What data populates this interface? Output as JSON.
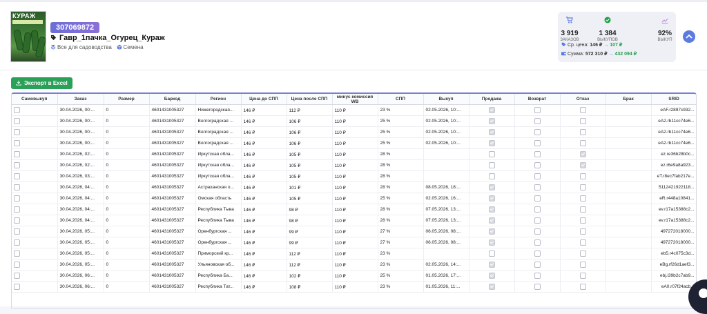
{
  "product": {
    "brand_logo": "КУРАЖ",
    "sku": "307069872",
    "name": "Гавр_1пачка_Огурец_Кураж",
    "category": "Все для садоводства",
    "subcategory": "Семена"
  },
  "stats": {
    "orders_value": "3 919",
    "orders_label": "ЗАКАЗОВ",
    "buyouts_value": "1 384",
    "buyouts_label": "ВЫКУПОВ",
    "buyout_pct_value": "92%",
    "buyout_pct_label": "ВЫКУП",
    "avg_price_label": "Ср. цена:",
    "avg_price_from": "146 ₽",
    "avg_price_to": "107 ₽",
    "sum_label": "Сумма:",
    "sum_from": "572 310 ₽",
    "sum_to": "432 094 ₽",
    "arrow": "→",
    "colors": {
      "orders": "#5b7be0",
      "buyouts": "#23a04a",
      "pct": "#b97de0"
    }
  },
  "toolbar": {
    "export_label": "Экспорт в Excel"
  },
  "table": {
    "columns": [
      "Самовыкуп",
      "Заказ",
      "Размер",
      "Баркод",
      "Регион",
      "Цена до СПП",
      "Цена после СПП",
      "минус комиссия WB",
      "СПП",
      "Выкуп",
      "Продажа",
      "Возврат",
      "Отказ",
      "Брак",
      "SRID"
    ],
    "rows": [
      {
        "order": "30.04.2026, 00:...",
        "size": "0",
        "barcode": "4601431005327",
        "region": "Нижегородская...",
        "p1": "146 ₽",
        "p2": "112 ₽",
        "p3": "110 ₽",
        "spp": "23 %",
        "buyout": "02.05.2026, 10:...",
        "sale": true,
        "refusal": false,
        "srid": "eAF.r2897c932..."
      },
      {
        "order": "30.04.2026, 00:...",
        "size": "0",
        "barcode": "4601431005327",
        "region": "Волгоградская ...",
        "p1": "146 ₽",
        "p2": "106 ₽",
        "p3": "110 ₽",
        "spp": "25 %",
        "buyout": "02.05.2026, 10:...",
        "sale": true,
        "refusal": false,
        "srid": "eA2.rb11cc74e6..."
      },
      {
        "order": "30.04.2026, 00:...",
        "size": "0",
        "barcode": "4601431005327",
        "region": "Волгоградская ...",
        "p1": "146 ₽",
        "p2": "106 ₽",
        "p3": "110 ₽",
        "spp": "25 %",
        "buyout": "02.05.2026, 10:...",
        "sale": true,
        "refusal": false,
        "srid": "eA2.rb11cc74e6..."
      },
      {
        "order": "30.04.2026, 00:...",
        "size": "0",
        "barcode": "4601431005327",
        "region": "Волгоградская ...",
        "p1": "146 ₽",
        "p2": "106 ₽",
        "p3": "110 ₽",
        "spp": "25 %",
        "buyout": "02.05.2026, 10:...",
        "sale": true,
        "refusal": false,
        "srid": "eA2.rb11cc74e6..."
      },
      {
        "order": "30.04.2026, 02:...",
        "size": "0",
        "barcode": "4601431005327",
        "region": "Иркутская обла...",
        "p1": "146 ₽",
        "p2": "105 ₽",
        "p3": "110 ₽",
        "spp": "28 %",
        "buyout": "",
        "sale": false,
        "refusal": true,
        "srid": "ez.re36b28b0c..."
      },
      {
        "order": "30.04.2026, 02:...",
        "size": "0",
        "barcode": "4601431005327",
        "region": "Иркутская обла...",
        "p1": "146 ₽",
        "p2": "105 ₽",
        "p3": "110 ₽",
        "spp": "28 %",
        "buyout": "",
        "sale": false,
        "refusal": true,
        "srid": "ez.r6e9a8a923..."
      },
      {
        "order": "30.04.2026, 03:...",
        "size": "0",
        "barcode": "4601431005327",
        "region": "Иркутская обла...",
        "p1": "146 ₽",
        "p2": "105 ₽",
        "p3": "110 ₽",
        "spp": "28 %",
        "buyout": "",
        "sale": false,
        "refusal": false,
        "srid": "eT.r8ec7fab217e..."
      },
      {
        "order": "30.04.2026, 04:...",
        "size": "0",
        "barcode": "4601431005327",
        "region": "Астраханская о...",
        "p1": "146 ₽",
        "p2": "101 ₽",
        "p3": "110 ₽",
        "spp": "28 %",
        "buyout": "08.05.2026, 18:...",
        "sale": true,
        "refusal": false,
        "srid": "5112421922118..."
      },
      {
        "order": "30.04.2026, 04:...",
        "size": "0",
        "barcode": "4601431005327",
        "region": "Омская область",
        "p1": "146 ₽",
        "p2": "105 ₽",
        "p3": "110 ₽",
        "spp": "25 %",
        "buyout": "02.05.2026, 16:...",
        "sale": true,
        "refusal": false,
        "srid": "eR.r448a10841..."
      },
      {
        "order": "30.04.2026, 04:...",
        "size": "0",
        "barcode": "4601431005327",
        "region": "Республика Тыва",
        "p1": "146 ₽",
        "p2": "98 ₽",
        "p3": "110 ₽",
        "spp": "28 %",
        "buyout": "07.05.2026, 13:...",
        "sale": true,
        "refusal": false,
        "srid": "ev.r17a15388c2..."
      },
      {
        "order": "30.04.2026, 04:...",
        "size": "0",
        "barcode": "4601431005327",
        "region": "Республика Тыва",
        "p1": "146 ₽",
        "p2": "98 ₽",
        "p3": "110 ₽",
        "spp": "28 %",
        "buyout": "07.05.2026, 13:...",
        "sale": true,
        "refusal": false,
        "srid": "ev.r17a15388c2..."
      },
      {
        "order": "30.04.2026, 05:...",
        "size": "0",
        "barcode": "4601431005327",
        "region": "Оренбургская ...",
        "p1": "146 ₽",
        "p2": "99 ₽",
        "p3": "110 ₽",
        "spp": "27 %",
        "buyout": "06.05.2026, 08:...",
        "sale": true,
        "refusal": false,
        "srid": "497272018000..."
      },
      {
        "order": "30.04.2026, 05:...",
        "size": "0",
        "barcode": "4601431005327",
        "region": "Оренбургская ...",
        "p1": "146 ₽",
        "p2": "99 ₽",
        "p3": "110 ₽",
        "spp": "27 %",
        "buyout": "06.05.2026, 08:...",
        "sale": true,
        "refusal": false,
        "srid": "497272018000..."
      },
      {
        "order": "30.04.2026, 05:...",
        "size": "0",
        "barcode": "4601431005327",
        "region": "Приморский кр...",
        "p1": "146 ₽",
        "p2": "112 ₽",
        "p3": "110 ₽",
        "spp": "23 %",
        "buyout": "",
        "sale": false,
        "refusal": false,
        "srid": "eb5.r4c075c3d..."
      },
      {
        "order": "30.04.2026, 05:...",
        "size": "0",
        "barcode": "4601431005327",
        "region": "Ульяновская об...",
        "p1": "146 ₽",
        "p2": "112 ₽",
        "p3": "110 ₽",
        "spp": "23 %",
        "buyout": "02.05.2026, 14:...",
        "sale": true,
        "refusal": false,
        "srid": "eBg.rf26d1aef3..."
      },
      {
        "order": "30.04.2026, 06:...",
        "size": "0",
        "barcode": "4601431005327",
        "region": "Республика Ба...",
        "p1": "146 ₽",
        "p2": "102 ₽",
        "p3": "110 ₽",
        "spp": "25 %",
        "buyout": "01.05.2026, 17:...",
        "sale": true,
        "refusal": false,
        "srid": "ebj.i39b2c7ab9..."
      },
      {
        "order": "30.04.2026, 06:...",
        "size": "0",
        "barcode": "4601431005327",
        "region": "Республика Тат...",
        "p1": "146 ₽",
        "p2": "108 ₽",
        "p3": "110 ₽",
        "spp": "23 %",
        "buyout": "01.05.2026, 11:...",
        "sale": true,
        "refusal": false,
        "srid": "eA0.r07f24acb..."
      }
    ]
  }
}
